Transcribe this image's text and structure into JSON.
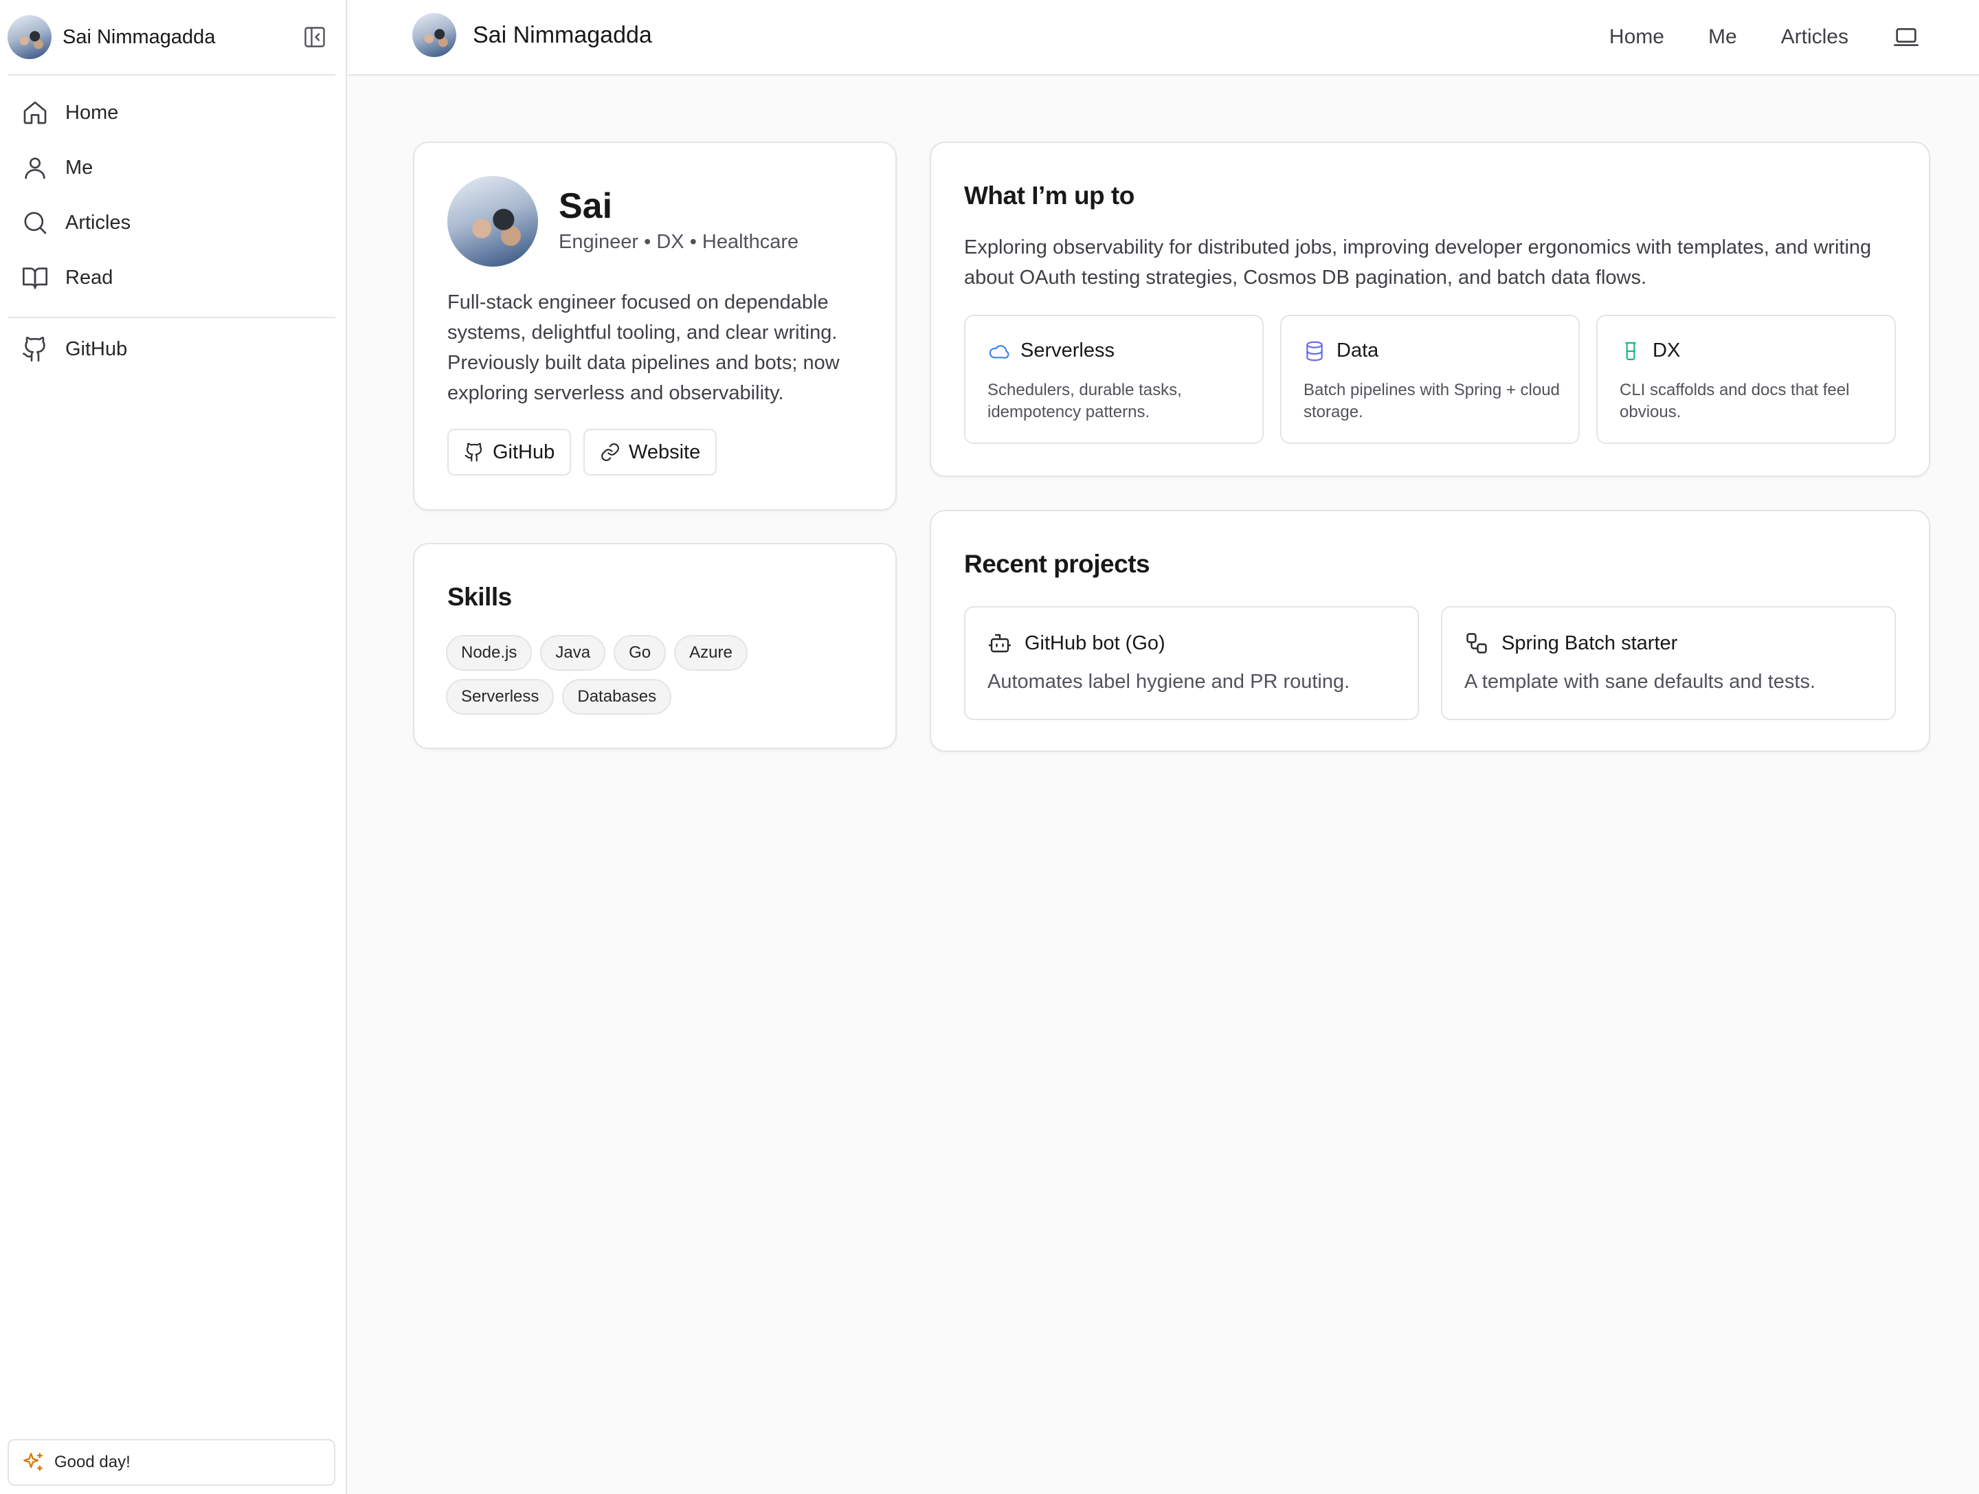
{
  "sidebar": {
    "title": "Sai Nimmagadda",
    "nav": [
      {
        "label": "Home",
        "icon": "home-icon"
      },
      {
        "label": "Me",
        "icon": "user-icon"
      },
      {
        "label": "Articles",
        "icon": "search-icon"
      },
      {
        "label": "Read",
        "icon": "book-open-icon"
      }
    ],
    "github_label": "GitHub",
    "footer_label": "Good day!"
  },
  "topbar": {
    "title": "Sai Nimmagadda",
    "links": [
      "Home",
      "Me",
      "Articles"
    ]
  },
  "profile": {
    "name": "Sai",
    "role": "Engineer • DX • Healthcare",
    "bio": "Full-stack engineer focused on dependable systems, delightful tooling, and clear writing. Previously built data pipelines and bots; now exploring serverless and observability.",
    "buttons": [
      "GitHub",
      "Website"
    ]
  },
  "skills": {
    "title": "Skills",
    "items": [
      "Node.js",
      "Java",
      "Go",
      "Azure",
      "Serverless",
      "Databases"
    ]
  },
  "upto": {
    "title": "What I’m up to",
    "description": "Exploring observability for distributed jobs, improving developer ergonomics with templates, and writing about OAuth testing strategies, Cosmos DB pagination, and batch data flows.",
    "cards": [
      {
        "title": "Serverless",
        "desc": "Schedulers, durable tasks, idempotency patterns.",
        "icon": "cloud-icon",
        "color": "#3b82f6"
      },
      {
        "title": "Data",
        "desc": "Batch pipelines with Spring + cloud storage.",
        "icon": "database-icon",
        "color": "#6366f1"
      },
      {
        "title": "DX",
        "desc": "CLI scaffolds and docs that feel obvious.",
        "icon": "beaker-icon",
        "color": "#10b981"
      }
    ]
  },
  "projects": {
    "title": "Recent projects",
    "items": [
      {
        "title": "GitHub bot (Go)",
        "desc": "Automates label hygiene and PR routing.",
        "icon": "bot-icon"
      },
      {
        "title": "Spring Batch starter",
        "desc": "A template with sane defaults and tests.",
        "icon": "workflow-icon"
      }
    ]
  },
  "colors": {
    "accent_serverless": "#3b82f6",
    "accent_data": "#6366f1",
    "accent_dx": "#10b981",
    "sparkle": "#d97706"
  }
}
